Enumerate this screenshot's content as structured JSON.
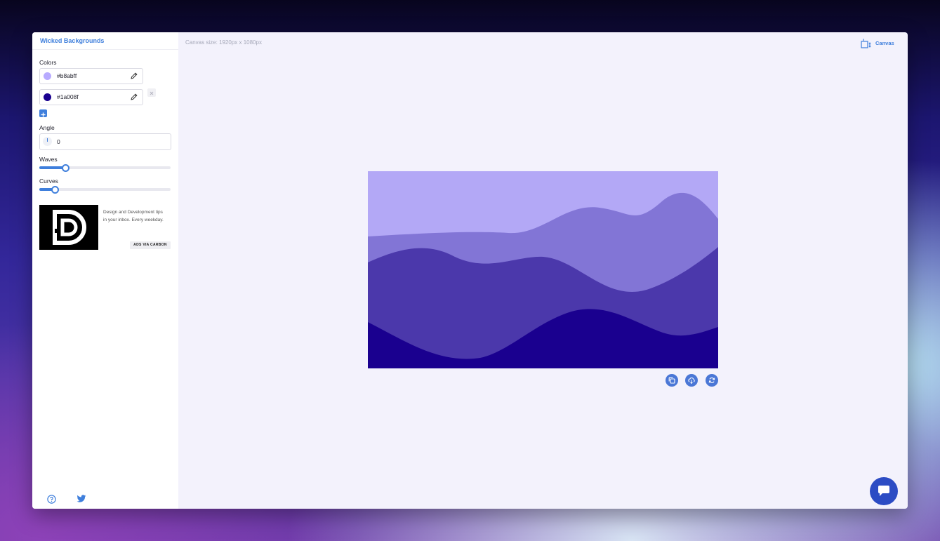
{
  "app": {
    "title": "Wicked Backgrounds"
  },
  "sidebar": {
    "colors_label": "Colors",
    "colors": [
      {
        "hex": "#b8abff",
        "swatch": "#b8abff"
      },
      {
        "hex": "#1a008f",
        "swatch": "#1a008f"
      }
    ],
    "angle_label": "Angle",
    "angle_value": "0",
    "waves_label": "Waves",
    "waves_level": 0.2,
    "curves_label": "Curves",
    "curves_level": 0.12,
    "ad": {
      "text": "Design and Development tips in your inbox. Every weekday.",
      "tag": "ADS VIA CARBON"
    },
    "footer_icons": [
      "help-icon",
      "twitter-icon"
    ]
  },
  "main": {
    "canvas_size": "Canvas size: 1920px x 1080px",
    "canvas_button": "Canvas",
    "actions": [
      "copy-icon",
      "download-icon",
      "refresh-icon"
    ]
  },
  "colors": {
    "accent": "#3f7fdc",
    "wave_layers": [
      "#b3a8f6",
      "#8275d6",
      "#4b38ab",
      "#1a008f"
    ]
  }
}
